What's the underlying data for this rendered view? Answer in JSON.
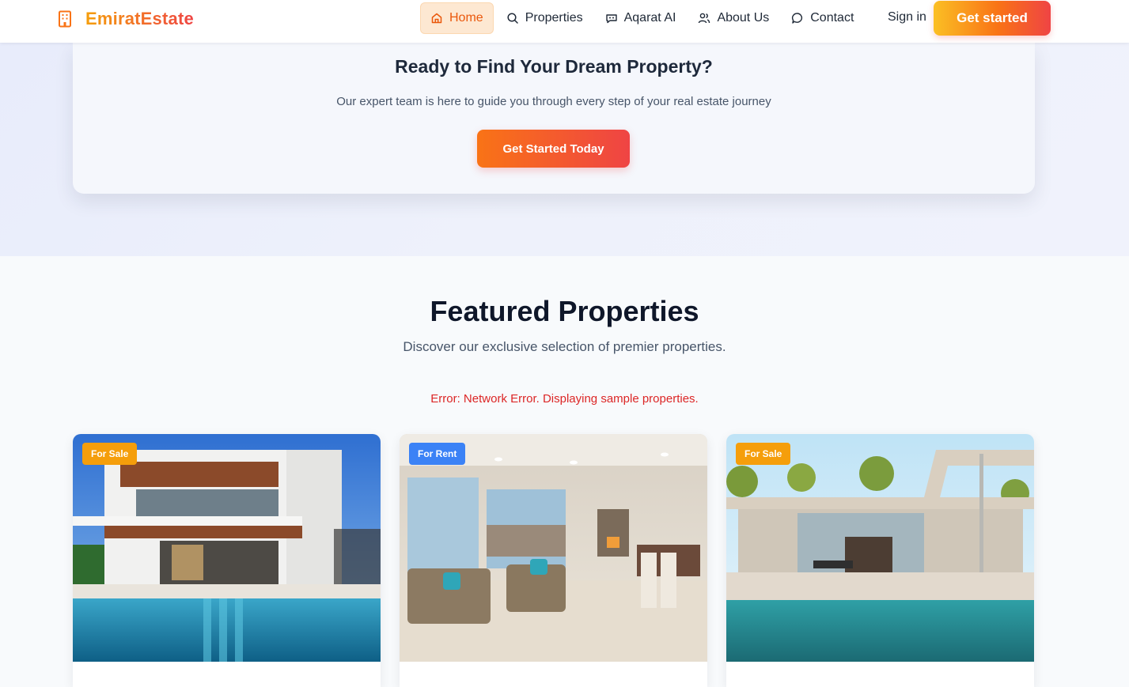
{
  "brand": {
    "name": "EmiratEstate",
    "logo_icon": "building-icon"
  },
  "nav": {
    "items": [
      {
        "label": "Home",
        "icon": "home-icon",
        "active": true
      },
      {
        "label": "Properties",
        "icon": "search-icon"
      },
      {
        "label": "Aqarat AI",
        "icon": "bot-icon"
      },
      {
        "label": "About Us",
        "icon": "users-icon"
      },
      {
        "label": "Contact",
        "icon": "chat-icon"
      }
    ],
    "sign_in": "Sign in",
    "get_started": "Get started"
  },
  "cta": {
    "title": "Ready to Find Your Dream Property?",
    "subtitle": "Our expert team is here to guide you through every step of your real estate journey",
    "button": "Get Started Today"
  },
  "featured": {
    "title": "Featured Properties",
    "subtitle": "Discover our exclusive selection of premier properties.",
    "error": "Error: Network Error. Displaying sample properties.",
    "cards": [
      {
        "badge": "For Sale",
        "badge_type": "sale"
      },
      {
        "badge": "For Rent",
        "badge_type": "rent"
      },
      {
        "badge": "For Sale",
        "badge_type": "sale"
      }
    ]
  },
  "colors": {
    "brand_orange": "#f97316",
    "brand_red": "#ef4444",
    "sale_badge": "#f59e0b",
    "rent_badge": "#3b82f6",
    "error": "#dc2626"
  }
}
